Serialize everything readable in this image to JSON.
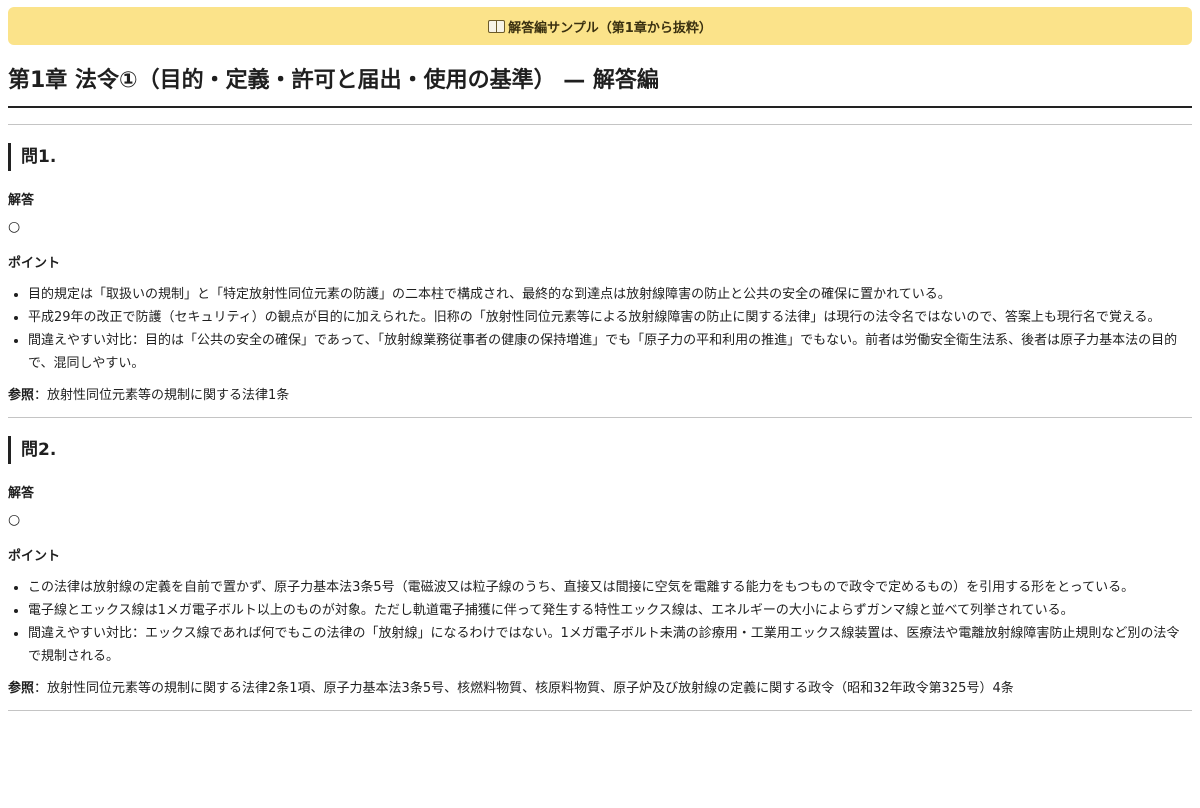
{
  "banner": {
    "text": "解答編サンプル（第1章から抜粋）"
  },
  "page_title": "第1章 法令①（目的・定義・許可と届出・使用の基準） — 解答編",
  "labels": {
    "answer": "解答",
    "points": "ポイント",
    "reference": "参照"
  },
  "questions": [
    {
      "heading": "問1.",
      "answer": "○",
      "points": [
        "目的規定は「取扱いの規制」と「特定放射性同位元素の防護」の二本柱で構成され、最終的な到達点は放射線障害の防止と公共の安全の確保に置かれている。",
        "平成29年の改正で防護（セキュリティ）の観点が目的に加えられた。旧称の「放射性同位元素等による放射線障害の防止に関する法律」は現行の法令名ではないので、答案上も現行名で覚える。",
        "間違えやすい対比：目的は「公共の安全の確保」であって、「放射線業務従事者の健康の保持増進」でも「原子力の平和利用の推進」でもない。前者は労働安全衛生法系、後者は原子力基本法の目的で、混同しやすい。"
      ],
      "reference": "：放射性同位元素等の規制に関する法律1条"
    },
    {
      "heading": "問2.",
      "answer": "○",
      "points": [
        "この法律は放射線の定義を自前で置かず、原子力基本法3条5号（電磁波又は粒子線のうち、直接又は間接に空気を電離する能力をもつもので政令で定めるもの）を引用する形をとっている。",
        "電子線とエックス線は1メガ電子ボルト以上のものが対象。ただし軌道電子捕獲に伴って発生する特性エックス線は、エネルギーの大小によらずガンマ線と並べて列挙されている。",
        "間違えやすい対比：エックス線であれば何でもこの法律の「放射線」になるわけではない。1メガ電子ボルト未満の診療用・工業用エックス線装置は、医療法や電離放射線障害防止規則など別の法令で規制される。"
      ],
      "reference": "：放射性同位元素等の規制に関する法律2条1項、原子力基本法3条5号、核燃料物質、核原料物質、原子炉及び放射線の定義に関する政令（昭和32年政令第325号）4条"
    }
  ]
}
